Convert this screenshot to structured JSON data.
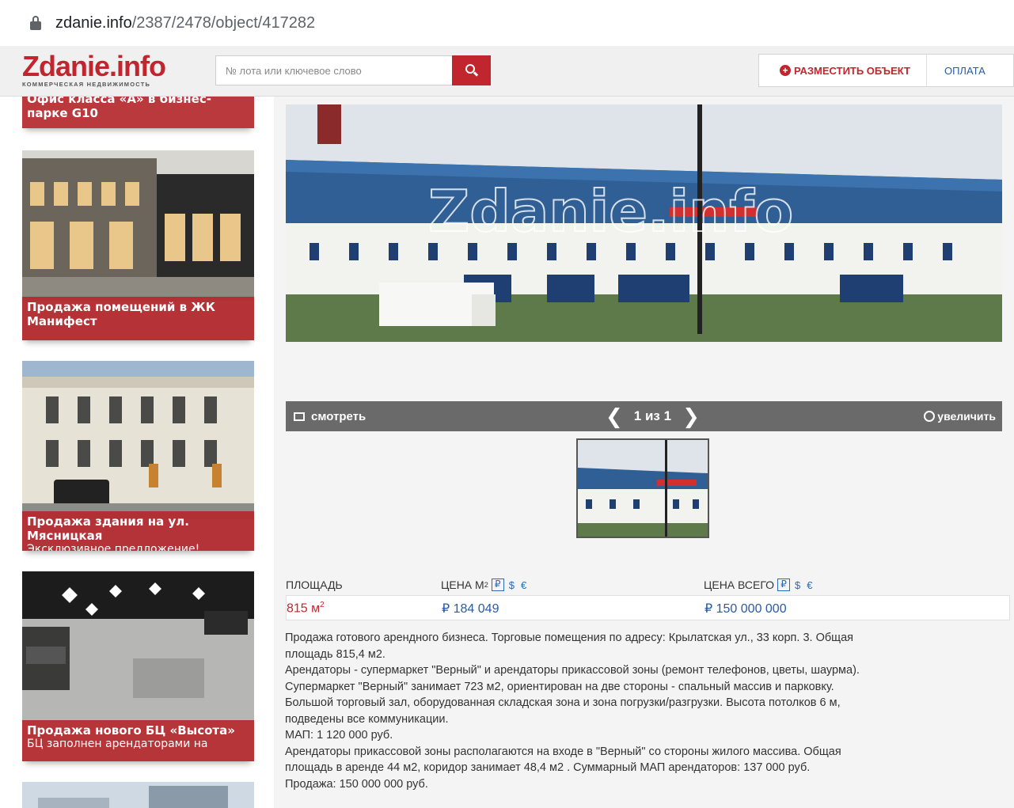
{
  "browser": {
    "url_host": "zdanie.info",
    "url_path": "/2387/2478/object/417282"
  },
  "header": {
    "logo_main": "Zdanie.info",
    "logo_sub": "КОММЕРЧЕСКАЯ НЕДВИЖИМОСТЬ",
    "search_placeholder": "№ лота или ключевое слово",
    "place_object": "РАЗМЕСТИТЬ ОБЪЕКТ",
    "payment": "ОПЛАТА",
    "brand_color": "#c1262e"
  },
  "sidebar": {
    "cards": [
      {
        "title": "Офис класса «А» в бизнес-парке G10",
        "subtitle": ""
      },
      {
        "title": "Продажа помещений в ЖК Манифест",
        "subtitle": ""
      },
      {
        "title": "Продажа здания на ул. Мясницкая",
        "subtitle": "Эксклюзивное предложение!"
      },
      {
        "title": "Продажа нового БЦ «Высота»",
        "subtitle": "БЦ заполнен арендаторами на"
      }
    ]
  },
  "gallery": {
    "watermark": "Zdanie.info",
    "watch_label": "смотреть",
    "counter": "1 из 1",
    "zoom_label": "увеличить",
    "prev_icon": "chevron-left-icon",
    "next_icon": "chevron-right-icon"
  },
  "prices": {
    "area_header": "ПЛОЩАДЬ",
    "price_m2_header": "ЦЕНА М",
    "price_m2_sup": "2",
    "total_header": "ЦЕНА ВСЕГО",
    "cur_rub": "₽",
    "cur_usd": "$",
    "cur_eur": "€",
    "area_value": "815 м",
    "area_sup": "2",
    "price_m2_value": "₽ 184 049",
    "total_value": "₽ 150 000 000"
  },
  "description": {
    "lines": [
      "Продажа готового арендного бизнеса. Торговые помещения по адресу: Крылатская ул., 33 корп. 3. Общая",
      "площадь 815,4 м2.",
      "Арендаторы - супермаркет \"Верный\" и арендаторы прикассовой зоны (ремонт телефонов, цветы, шаурма).",
      "Супермаркет \"Верный\" занимает 723 м2, ориентирован на две стороны - спальный массив и парковку.",
      "Большой торговый зал, оборудованная складская зона и зона погрузки/разгрузки. Высота потолков 6 м,",
      "подведены все коммуникации.",
      "МАП: 1 120 000 руб.",
      "Арендаторы прикассовой зоны располагаются на входе в \"Верный\" со стороны жилого массива. Общая",
      "площадь в аренде 44 м2, коридор занимает 48,4 м2 . Суммарный МАП арендаторов: 137 000 руб.",
      "Продажа: 150 000 000 руб."
    ]
  }
}
